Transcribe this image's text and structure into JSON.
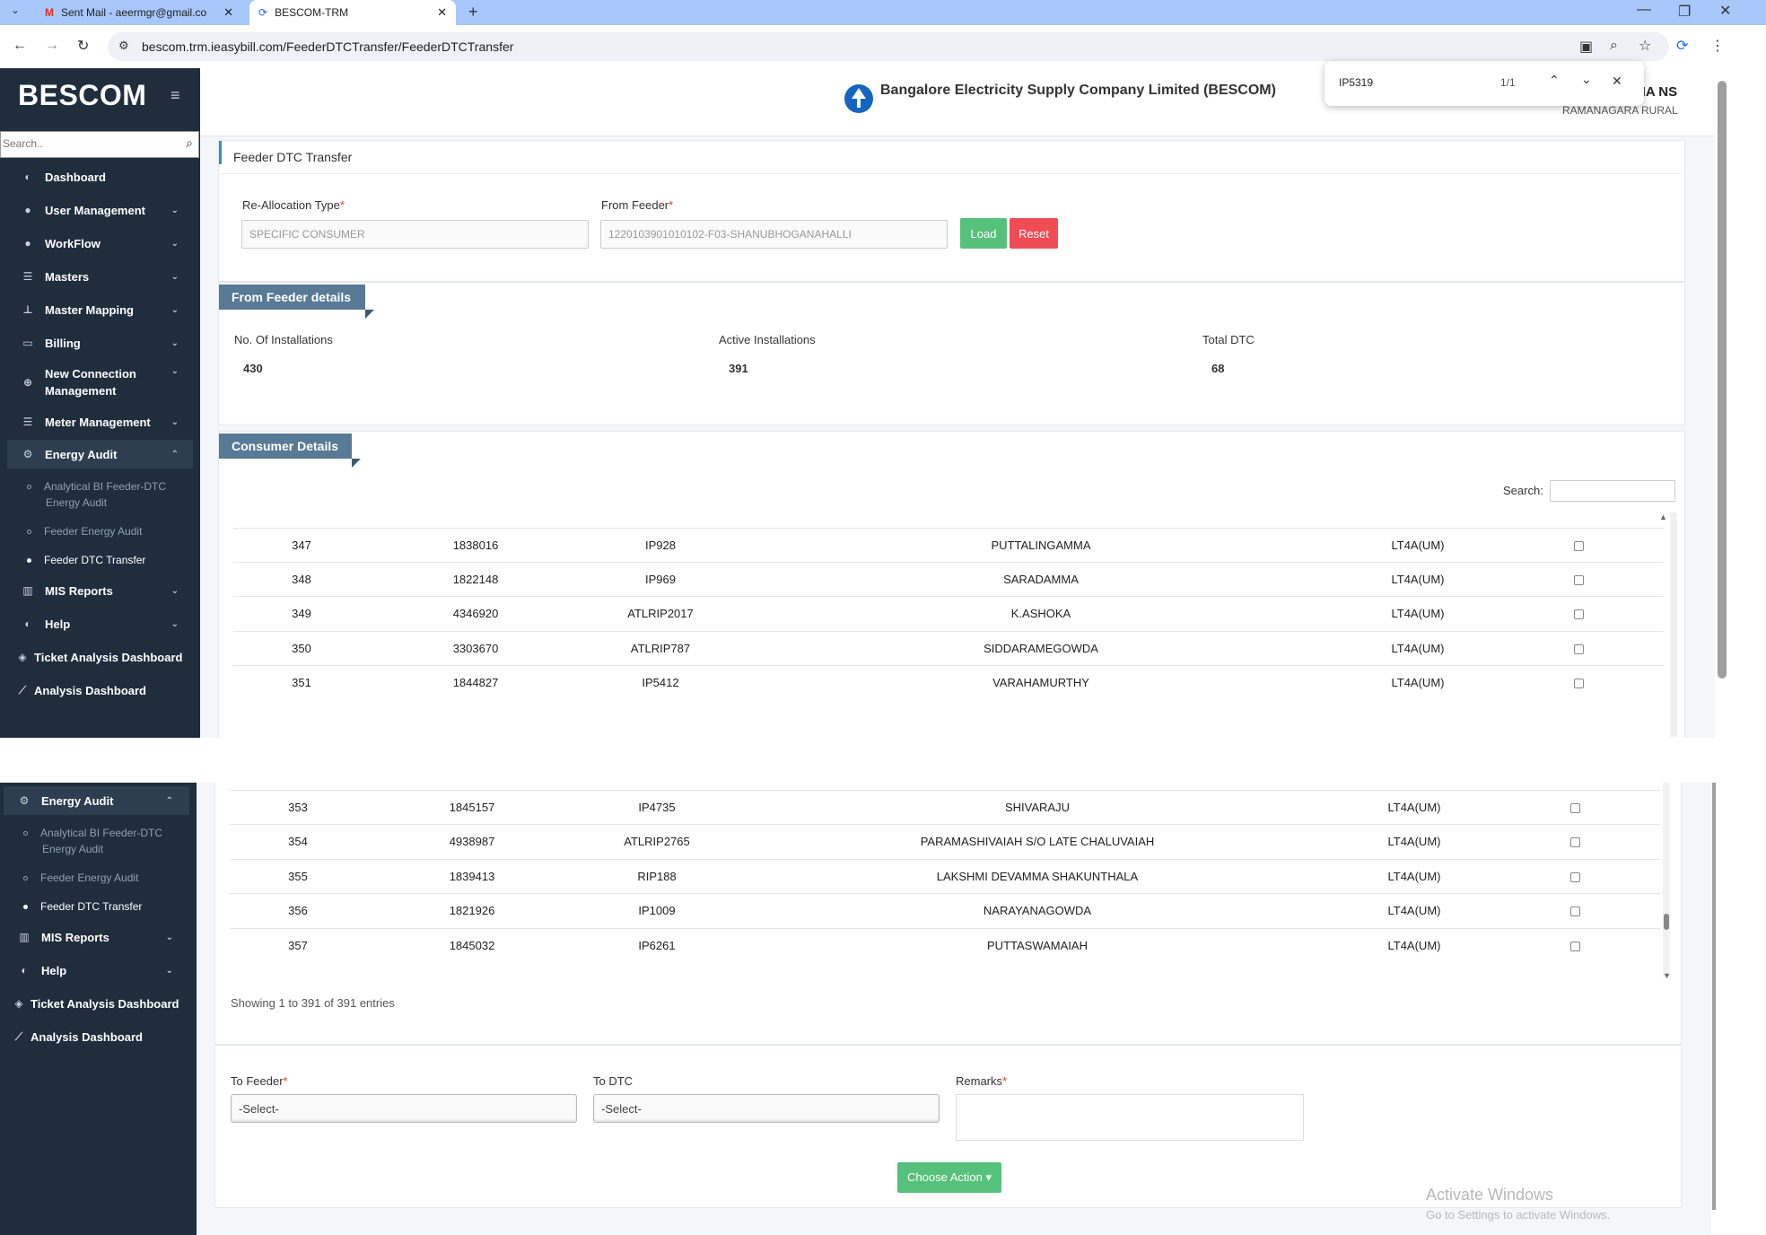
{
  "browser": {
    "tabs": [
      {
        "label": "Sent Mail - aeermgr@gmail.co",
        "icon": "gmail-icon"
      },
      {
        "label": "BESCOM-TRM",
        "icon": "bescom-icon"
      }
    ],
    "url": "bescom.trm.ieasybill.com/FeederDTCTransfer/FeederDTCTransfer",
    "find": {
      "query": "IP5319",
      "count": "1/1"
    }
  },
  "app": {
    "logo": "BESCOM",
    "company": "Bangalore Electricity Supply Company Limited (BESCOM)",
    "user_name_partial": "HA NS",
    "user_location": "RAMANAGARA RURAL",
    "search_placeholder": "Search.."
  },
  "sidebar": {
    "items": [
      {
        "label": "Dashboard",
        "icon": "palette-icon"
      },
      {
        "label": "User Management",
        "icon": "user-icon"
      },
      {
        "label": "WorkFlow",
        "icon": "user-icon"
      },
      {
        "label": "Masters",
        "icon": "list-icon"
      },
      {
        "label": "Master Mapping",
        "icon": "sitemap-icon"
      },
      {
        "label": "Billing",
        "icon": "monitor-icon"
      },
      {
        "label": "New Connection",
        "label2": "Management",
        "icon": "plus-circle-icon"
      },
      {
        "label": "Meter Management",
        "icon": "list-icon"
      },
      {
        "label": "Energy Audit",
        "icon": "cogs-icon"
      }
    ],
    "sub_items": [
      {
        "label": "Analytical BI Feeder-DTC",
        "label2": "Energy Audit"
      },
      {
        "label": "Feeder Energy Audit"
      },
      {
        "label": "Feeder DTC Transfer"
      }
    ],
    "bottom_items": [
      {
        "label": "MIS Reports",
        "icon": "bar-chart-icon"
      },
      {
        "label": "Help",
        "icon": "palette-icon"
      },
      {
        "label": "Ticket Analysis Dashboard",
        "icon": "ticket-icon"
      },
      {
        "label": "Analysis Dashboard",
        "icon": "line-chart-icon"
      }
    ]
  },
  "page": {
    "title": "Feeder DTC Transfer",
    "realloc_label": "Re-Allocation Type",
    "realloc_value": "SPECIFIC CONSUMER",
    "from_feeder_label": "From Feeder",
    "from_feeder_value": "1220103901010102-F03-SHANUBHOGANAHALLI",
    "load_btn": "Load",
    "reset_btn": "Reset",
    "from_feeder_details": "From Feeder details",
    "stats": [
      {
        "label": "No. Of Installations",
        "value": "430"
      },
      {
        "label": "Active Installations",
        "value": "391"
      },
      {
        "label": "Total DTC",
        "value": "68"
      }
    ],
    "consumer_details": "Consumer Details",
    "search_label": "Search:",
    "showing": "Showing 1 to 391 of 391 entries",
    "to_feeder_label": "To Feeder",
    "to_dtc_label": "To DTC",
    "remarks_label": "Remarks",
    "select_placeholder": "-Select-",
    "choose_action": "Choose Action ▾",
    "windows_line1": "Activate Windows",
    "windows_line2": "Go to Settings to activate Windows."
  },
  "rows_top": [
    {
      "sl": "347",
      "acc": "1838016",
      "rr": "IP928",
      "name": "PUTTALINGAMMA",
      "tariff": "LT4A(UM)"
    },
    {
      "sl": "348",
      "acc": "1822148",
      "rr": "IP969",
      "name": "SARADAMMA",
      "tariff": "LT4A(UM)"
    },
    {
      "sl": "349",
      "acc": "4346920",
      "rr": "ATLRIP2017",
      "name": "K.ASHOKA",
      "tariff": "LT4A(UM)"
    },
    {
      "sl": "350",
      "acc": "3303670",
      "rr": "ATLRIP787",
      "name": "SIDDARAMEGOWDA",
      "tariff": "LT4A(UM)"
    },
    {
      "sl": "351",
      "acc": "1844827",
      "rr": "IP5412",
      "name": "VARAHAMURTHY",
      "tariff": "LT4A(UM)"
    }
  ],
  "rows_bottom": [
    {
      "sl": "353",
      "acc": "1845157",
      "rr": "IP4735",
      "name": "SHIVARAJU",
      "tariff": "LT4A(UM)"
    },
    {
      "sl": "354",
      "acc": "4938987",
      "rr": "ATLRIP2765",
      "name": "PARAMASHIVAIAH S/O LATE CHALUVAIAH",
      "tariff": "LT4A(UM)"
    },
    {
      "sl": "355",
      "acc": "1839413",
      "rr": "RIP188",
      "name": "LAKSHMI DEVAMMA SHAKUNTHALA",
      "tariff": "LT4A(UM)"
    },
    {
      "sl": "356",
      "acc": "1821926",
      "rr": "IP1009",
      "name": "NARAYANAGOWDA",
      "tariff": "LT4A(UM)"
    },
    {
      "sl": "357",
      "acc": "1845032",
      "rr": "IP6261",
      "name": "PUTTASWAMAIAH",
      "tariff": "LT4A(UM)"
    }
  ]
}
